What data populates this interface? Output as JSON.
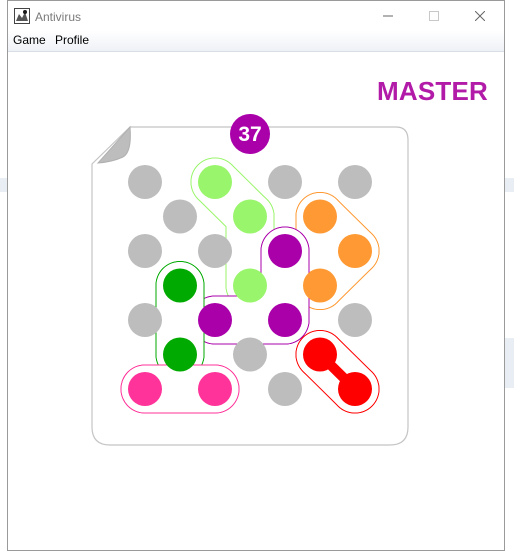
{
  "window": {
    "title": "Antivirus",
    "controls": {
      "minimize": "—",
      "maximize": "☐",
      "close": "✕"
    }
  },
  "menu": {
    "items": [
      "Game",
      "Profile"
    ]
  },
  "game": {
    "level": "MASTER",
    "moves": "37",
    "colors": {
      "empty": "#bdbdbd",
      "light_green": "#99f56b",
      "dark_green": "#00aa00",
      "orange": "#ff9933",
      "purple": "#aa00aa",
      "pink": "#ff3399",
      "red": "#ff0000",
      "counter_badge": "#aa00aa"
    },
    "cells": [
      {
        "row": 0,
        "col": 0,
        "color": "empty"
      },
      {
        "row": 0,
        "col": 2,
        "color": "light_green"
      },
      {
        "row": 0,
        "col": 4,
        "color": "empty"
      },
      {
        "row": 0,
        "col": 6,
        "color": "empty"
      },
      {
        "row": 1,
        "col": 1,
        "color": "empty"
      },
      {
        "row": 1,
        "col": 3,
        "color": "light_green"
      },
      {
        "row": 1,
        "col": 5,
        "color": "orange"
      },
      {
        "row": 2,
        "col": 0,
        "color": "empty"
      },
      {
        "row": 2,
        "col": 2,
        "color": "empty"
      },
      {
        "row": 2,
        "col": 4,
        "color": "purple"
      },
      {
        "row": 2,
        "col": 6,
        "color": "orange"
      },
      {
        "row": 3,
        "col": 1,
        "color": "dark_green"
      },
      {
        "row": 3,
        "col": 3,
        "color": "light_green"
      },
      {
        "row": 3,
        "col": 5,
        "color": "orange"
      },
      {
        "row": 4,
        "col": 0,
        "color": "empty"
      },
      {
        "row": 4,
        "col": 2,
        "color": "purple"
      },
      {
        "row": 4,
        "col": 4,
        "color": "purple"
      },
      {
        "row": 4,
        "col": 6,
        "color": "empty"
      },
      {
        "row": 5,
        "col": 1,
        "color": "dark_green"
      },
      {
        "row": 5,
        "col": 3,
        "color": "empty"
      },
      {
        "row": 5,
        "col": 5,
        "color": "red"
      },
      {
        "row": 6,
        "col": 0,
        "color": "pink"
      },
      {
        "row": 6,
        "col": 2,
        "color": "pink"
      },
      {
        "row": 6,
        "col": 4,
        "color": "empty"
      },
      {
        "row": 6,
        "col": 6,
        "color": "red"
      }
    ],
    "pieces": [
      {
        "name": "light-green-piece",
        "color": "light_green",
        "cells": [
          [
            0,
            2
          ],
          [
            1,
            3
          ],
          [
            3,
            3
          ]
        ]
      },
      {
        "name": "orange-piece",
        "color": "orange",
        "cells": [
          [
            1,
            5
          ],
          [
            2,
            6
          ],
          [
            3,
            5
          ]
        ]
      },
      {
        "name": "purple-piece",
        "color": "purple",
        "cells": [
          [
            2,
            4
          ],
          [
            4,
            2
          ],
          [
            4,
            4
          ]
        ]
      },
      {
        "name": "dark-green-piece",
        "color": "dark_green",
        "cells": [
          [
            3,
            1
          ],
          [
            5,
            1
          ]
        ]
      },
      {
        "name": "pink-piece",
        "color": "pink",
        "cells": [
          [
            6,
            0
          ],
          [
            6,
            2
          ]
        ]
      },
      {
        "name": "red-virus-piece",
        "color": "red",
        "cells": [
          [
            5,
            5
          ],
          [
            6,
            6
          ]
        ]
      }
    ]
  }
}
